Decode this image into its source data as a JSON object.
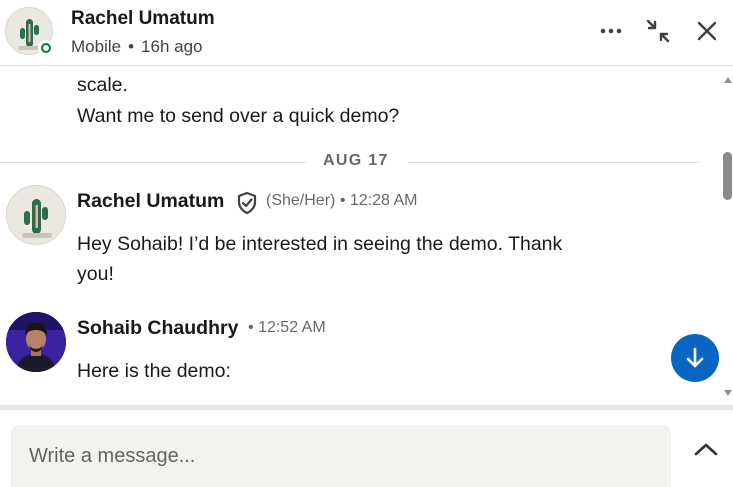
{
  "header": {
    "name": "Rachel Umatum",
    "device": "Mobile",
    "separator": "•",
    "last_active": "16h ago",
    "icons": [
      "more-options-icon",
      "collapse-icon",
      "close-icon"
    ]
  },
  "thread": {
    "previous_message": {
      "lines": [
        "scale.",
        "Want me to send over a quick demo?"
      ]
    },
    "date_divider": "AUG 17",
    "messages": [
      {
        "sender": "Rachel Umatum",
        "verified_icon": "verified-shield-icon",
        "pronouns": "(She/Her)",
        "dot": "•",
        "time": "12:28 AM",
        "lines": [
          "Hey Sohaib! I’d be interested in seeing the demo. Thank",
          "you!"
        ]
      },
      {
        "sender": "Sohaib Chaudhry",
        "dot": "•",
        "time": "12:52 AM",
        "lines": [
          "Here is the demo:"
        ]
      }
    ]
  },
  "composer": {
    "placeholder": "Write a message...",
    "value": ""
  },
  "colors": {
    "accent": "#0a66c2",
    "presence": "#057642",
    "composer_bg": "#f4f2ee"
  }
}
